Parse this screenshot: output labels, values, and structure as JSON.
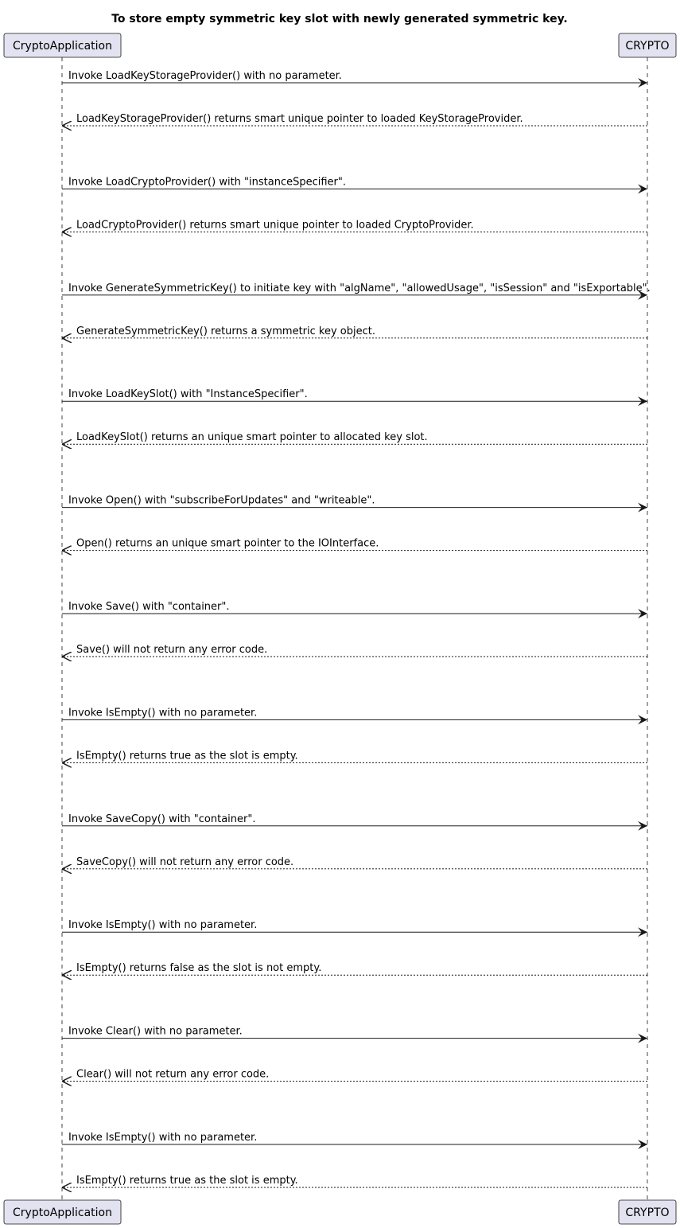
{
  "diagram": {
    "title": "To store empty symmetric key slot with newly generated symmetric key.",
    "participants": [
      {
        "id": "app",
        "label": "CryptoApplication"
      },
      {
        "id": "crypto",
        "label": "CRYPTO"
      }
    ],
    "messages": [
      {
        "from": "app",
        "to": "crypto",
        "kind": "call",
        "text": "Invoke LoadKeyStorageProvider() with no parameter."
      },
      {
        "from": "crypto",
        "to": "app",
        "kind": "return",
        "text": "LoadKeyStorageProvider() returns smart unique pointer to loaded KeyStorageProvider."
      },
      {
        "from": "app",
        "to": "crypto",
        "kind": "call",
        "text": "Invoke LoadCryptoProvider() with \"instanceSpecifier\"."
      },
      {
        "from": "crypto",
        "to": "app",
        "kind": "return",
        "text": "LoadCryptoProvider() returns smart unique pointer to loaded CryptoProvider."
      },
      {
        "from": "app",
        "to": "crypto",
        "kind": "call",
        "text": "Invoke GenerateSymmetricKey() to initiate key with \"algName\", \"allowedUsage\", \"isSession\" and \"isExportable\"."
      },
      {
        "from": "crypto",
        "to": "app",
        "kind": "return",
        "text": "GenerateSymmetricKey() returns a symmetric key object."
      },
      {
        "from": "app",
        "to": "crypto",
        "kind": "call",
        "text": "Invoke LoadKeySlot() with \"InstanceSpecifier\"."
      },
      {
        "from": "crypto",
        "to": "app",
        "kind": "return",
        "text": "LoadKeySlot() returns an unique smart pointer to allocated key slot."
      },
      {
        "from": "app",
        "to": "crypto",
        "kind": "call",
        "text": "Invoke Open() with \"subscribeForUpdates\" and \"writeable\"."
      },
      {
        "from": "crypto",
        "to": "app",
        "kind": "return",
        "text": "Open() returns an unique smart pointer to the IOInterface."
      },
      {
        "from": "app",
        "to": "crypto",
        "kind": "call",
        "text": "Invoke Save() with \"container\"."
      },
      {
        "from": "crypto",
        "to": "app",
        "kind": "return",
        "text": "Save() will not return any error code."
      },
      {
        "from": "app",
        "to": "crypto",
        "kind": "call",
        "text": "Invoke IsEmpty() with no parameter."
      },
      {
        "from": "crypto",
        "to": "app",
        "kind": "return",
        "text": "IsEmpty() returns true as the slot is empty."
      },
      {
        "from": "app",
        "to": "crypto",
        "kind": "call",
        "text": "Invoke SaveCopy() with \"container\"."
      },
      {
        "from": "crypto",
        "to": "app",
        "kind": "return",
        "text": "SaveCopy() will not return any error code."
      },
      {
        "from": "app",
        "to": "crypto",
        "kind": "call",
        "text": "Invoke IsEmpty() with no parameter."
      },
      {
        "from": "crypto",
        "to": "app",
        "kind": "return",
        "text": "IsEmpty() returns false as the slot is not empty."
      },
      {
        "from": "app",
        "to": "crypto",
        "kind": "call",
        "text": "Invoke Clear() with no parameter."
      },
      {
        "from": "crypto",
        "to": "app",
        "kind": "return",
        "text": "Clear() will not return any error code."
      },
      {
        "from": "app",
        "to": "crypto",
        "kind": "call",
        "text": "Invoke IsEmpty() with no parameter."
      },
      {
        "from": "crypto",
        "to": "app",
        "kind": "return",
        "text": "IsEmpty() returns true as the slot is empty."
      }
    ]
  }
}
